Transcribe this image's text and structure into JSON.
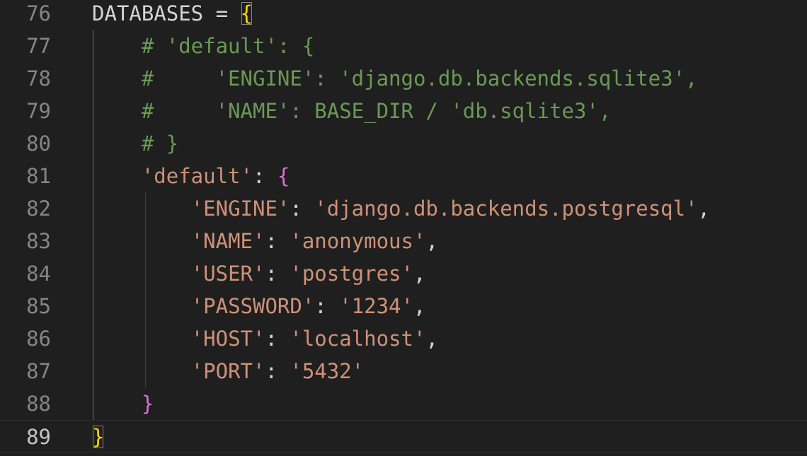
{
  "editor": {
    "lines": [
      {
        "number": "76",
        "segments": [
          {
            "text": "DATABASES",
            "cls": "kw-var"
          },
          {
            "text": " = ",
            "cls": "op"
          },
          {
            "text": "{",
            "cls": "brace-gold bracket-box"
          }
        ]
      },
      {
        "number": "77",
        "segments": [
          {
            "text": "    ",
            "cls": "op"
          },
          {
            "text": "# 'default': {",
            "cls": "comment"
          }
        ]
      },
      {
        "number": "78",
        "segments": [
          {
            "text": "    ",
            "cls": "op"
          },
          {
            "text": "#     'ENGINE': 'django.db.backends.sqlite3',",
            "cls": "comment"
          }
        ]
      },
      {
        "number": "79",
        "segments": [
          {
            "text": "    ",
            "cls": "op"
          },
          {
            "text": "#     'NAME': BASE_DIR / 'db.sqlite3',",
            "cls": "comment"
          }
        ]
      },
      {
        "number": "80",
        "segments": [
          {
            "text": "    ",
            "cls": "op"
          },
          {
            "text": "# }",
            "cls": "comment"
          }
        ]
      },
      {
        "number": "81",
        "segments": [
          {
            "text": "    ",
            "cls": "op"
          },
          {
            "text": "'default'",
            "cls": "str"
          },
          {
            "text": ": ",
            "cls": "punc"
          },
          {
            "text": "{",
            "cls": "brace-pink"
          }
        ]
      },
      {
        "number": "82",
        "segments": [
          {
            "text": "        ",
            "cls": "op"
          },
          {
            "text": "'ENGINE'",
            "cls": "str"
          },
          {
            "text": ": ",
            "cls": "punc"
          },
          {
            "text": "'django.db.backends.postgresql'",
            "cls": "str"
          },
          {
            "text": ",",
            "cls": "punc"
          }
        ]
      },
      {
        "number": "83",
        "segments": [
          {
            "text": "        ",
            "cls": "op"
          },
          {
            "text": "'NAME'",
            "cls": "str"
          },
          {
            "text": ": ",
            "cls": "punc"
          },
          {
            "text": "'anonymous'",
            "cls": "str"
          },
          {
            "text": ",",
            "cls": "punc"
          }
        ]
      },
      {
        "number": "84",
        "segments": [
          {
            "text": "        ",
            "cls": "op"
          },
          {
            "text": "'USER'",
            "cls": "str"
          },
          {
            "text": ": ",
            "cls": "punc"
          },
          {
            "text": "'postgres'",
            "cls": "str"
          },
          {
            "text": ",",
            "cls": "punc"
          }
        ]
      },
      {
        "number": "85",
        "segments": [
          {
            "text": "        ",
            "cls": "op"
          },
          {
            "text": "'PASSWORD'",
            "cls": "str"
          },
          {
            "text": ": ",
            "cls": "punc"
          },
          {
            "text": "'1234'",
            "cls": "str"
          },
          {
            "text": ",",
            "cls": "punc"
          }
        ]
      },
      {
        "number": "86",
        "segments": [
          {
            "text": "        ",
            "cls": "op"
          },
          {
            "text": "'HOST'",
            "cls": "str"
          },
          {
            "text": ": ",
            "cls": "punc"
          },
          {
            "text": "'localhost'",
            "cls": "str"
          },
          {
            "text": ",",
            "cls": "punc"
          }
        ]
      },
      {
        "number": "87",
        "segments": [
          {
            "text": "        ",
            "cls": "op"
          },
          {
            "text": "'PORT'",
            "cls": "str"
          },
          {
            "text": ": ",
            "cls": "punc"
          },
          {
            "text": "'5432'",
            "cls": "str"
          }
        ]
      },
      {
        "number": "88",
        "segments": [
          {
            "text": "    ",
            "cls": "op"
          },
          {
            "text": "}",
            "cls": "brace-pink"
          }
        ]
      },
      {
        "number": "89",
        "current": true,
        "segments": [
          {
            "text": "}",
            "cls": "brace-gold bracket-box"
          }
        ]
      }
    ]
  }
}
